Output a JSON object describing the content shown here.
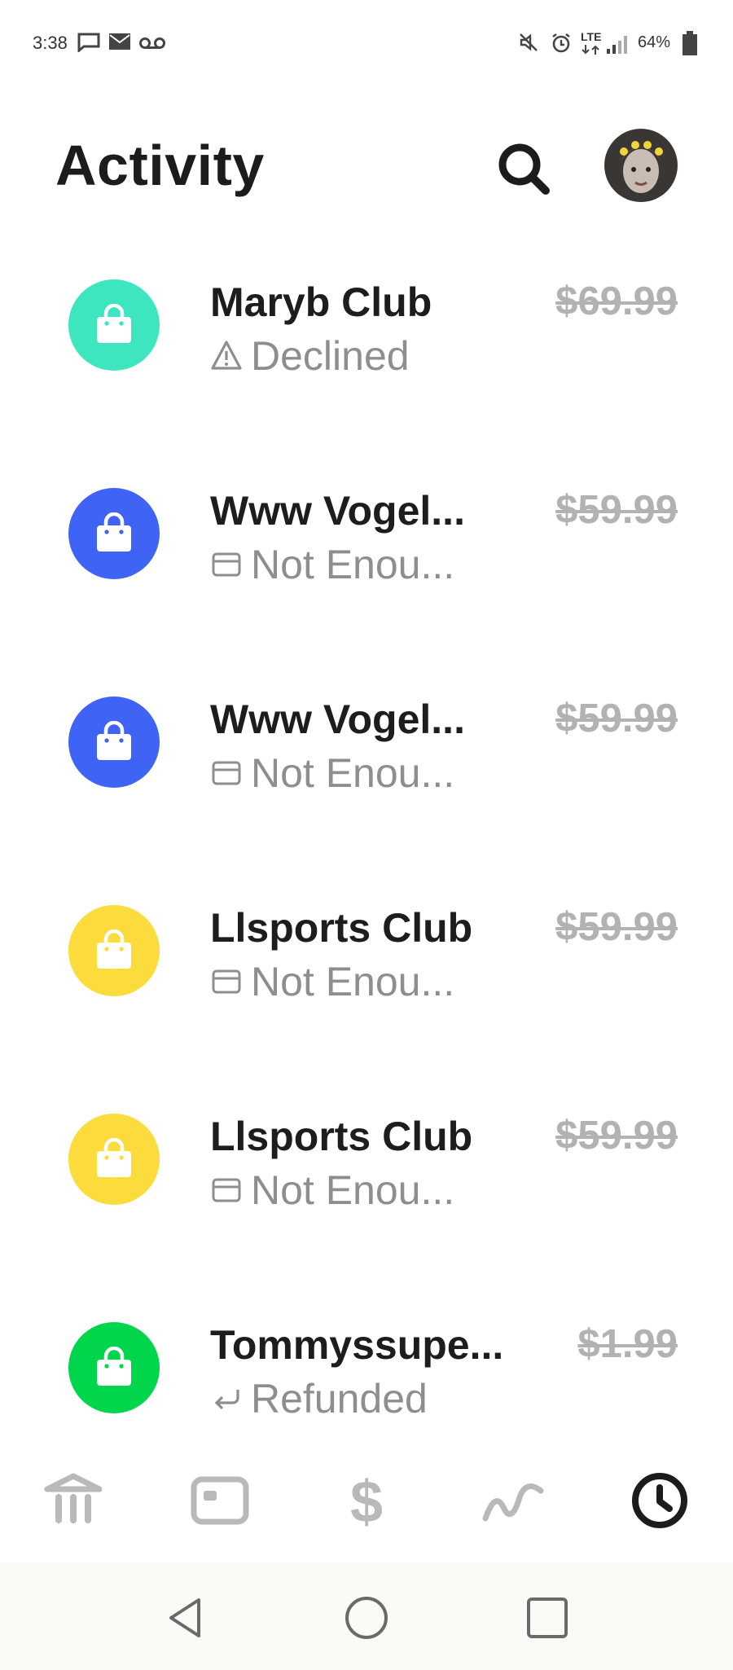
{
  "status_bar": {
    "time": "3:38",
    "network": "LTE",
    "battery": "64%"
  },
  "header": {
    "title": "Activity"
  },
  "activities": [
    {
      "merchant": "Maryb Club",
      "status": "Declined",
      "status_icon": "warning-icon",
      "amount": "$69.99",
      "color": "#3ee6bf"
    },
    {
      "merchant": "Www Vogel...",
      "status": "Not Enou...",
      "status_icon": "card-icon",
      "amount": "$59.99",
      "color": "#3f63f5"
    },
    {
      "merchant": "Www Vogel...",
      "status": "Not Enou...",
      "status_icon": "card-icon",
      "amount": "$59.99",
      "color": "#3f63f5"
    },
    {
      "merchant": "Llsports Club",
      "status": "Not Enou...",
      "status_icon": "card-icon",
      "amount": "$59.99",
      "color": "#fcdc3c"
    },
    {
      "merchant": "Llsports Club",
      "status": "Not Enou...",
      "status_icon": "card-icon",
      "amount": "$59.99",
      "color": "#fcdc3c"
    },
    {
      "merchant": "Tommyssupe...",
      "status": "Refunded",
      "status_icon": "refund-arrow-icon",
      "amount": "$1.99",
      "color": "#00d54b"
    }
  ],
  "tab_bar": {
    "tabs": [
      "bank-icon",
      "card-icon",
      "dollar-icon",
      "investing-icon",
      "activity-clock-icon"
    ],
    "active": "activity-clock-icon"
  }
}
